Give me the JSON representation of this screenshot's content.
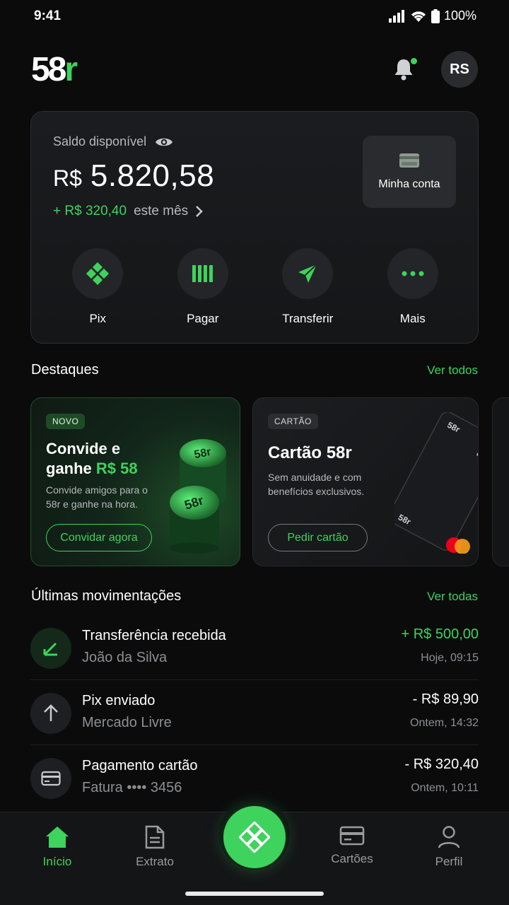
{
  "status_bar": {
    "time": "9:41",
    "battery": "100%"
  },
  "header": {
    "logo_main": "58",
    "logo_accent": "r",
    "avatar_initials": "RS"
  },
  "balance": {
    "label": "Saldo disponível",
    "currency": "R$",
    "amount": "5.820,58",
    "month_change": "+ R$ 320,40",
    "month_label": "este mês",
    "my_account_label": "Minha conta"
  },
  "actions": [
    {
      "label": "Pix"
    },
    {
      "label": "Pagar"
    },
    {
      "label": "Transferir"
    },
    {
      "label": "Mais"
    }
  ],
  "highlights": {
    "title": "Destaques",
    "see_all": "Ver todos",
    "invite": {
      "badge": "NOVO",
      "title_line1": "Convide e",
      "title_line2_prefix": "ganhe ",
      "title_line2_highlight": "R$ 58",
      "desc_line1": "Convide amigos para o",
      "desc_line2": "58r e ganhe na hora.",
      "cta": "Convidar agora",
      "coin_label": "58r"
    },
    "card": {
      "badge": "CARTÃO",
      "title": "Cartão 58r",
      "desc_line1": "Sem anuidade e com",
      "desc_line2": "benefícios exclusivos.",
      "cta": "Pedir cartão",
      "card_brand_text": "58r"
    }
  },
  "transactions": {
    "title": "Últimas movimentações",
    "see_all": "Ver todas",
    "items": [
      {
        "title": "Transferência recebida",
        "subtitle": "João da Silva",
        "amount": "+ R$ 500,00",
        "date": "Hoje, 09:15"
      },
      {
        "title": "Pix enviado",
        "subtitle": "Mercado Livre",
        "amount": "- R$ 89,90",
        "date": "Ontem, 14:32"
      },
      {
        "title": "Pagamento cartão",
        "subtitle": "Fatura •••• 3456",
        "amount": "- R$ 320,40",
        "date": "Ontem, 10:11"
      }
    ]
  },
  "bottom_nav": [
    {
      "label": "Início"
    },
    {
      "label": "Extrato"
    },
    {
      "label": "Cartões"
    },
    {
      "label": "Perfil"
    }
  ],
  "colors": {
    "accent": "#3ed35c",
    "background": "#0b0b0c",
    "card": "#1b1c1f"
  }
}
